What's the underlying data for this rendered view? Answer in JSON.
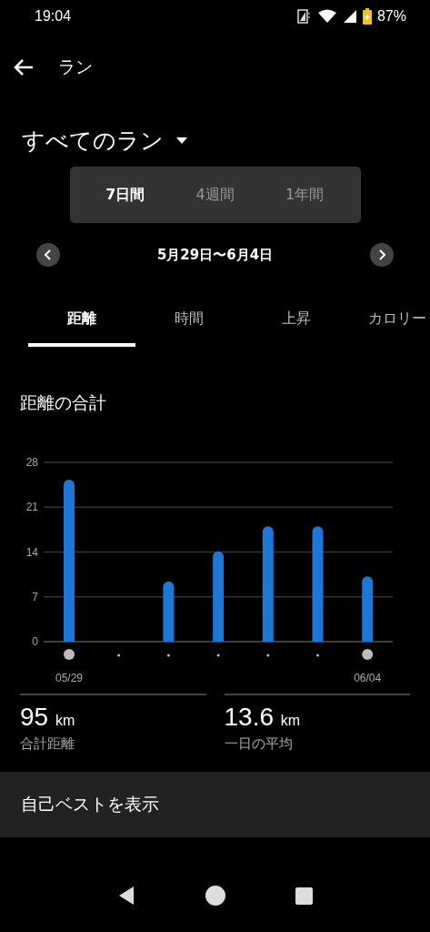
{
  "status_bar": {
    "time": "19:04",
    "battery": "87%"
  },
  "app_bar": {
    "title": "ラン"
  },
  "filter": {
    "label": "すべてのラン"
  },
  "periods": [
    {
      "label": "7日間",
      "selected": true
    },
    {
      "label": "4週間",
      "selected": false
    },
    {
      "label": "1年間",
      "selected": false
    }
  ],
  "date_range": "5月29日〜6月4日",
  "metric_tabs": [
    {
      "label": "距離",
      "selected": true
    },
    {
      "label": "時間",
      "selected": false
    },
    {
      "label": "上昇",
      "selected": false
    },
    {
      "label": "カロリー",
      "selected": false
    }
  ],
  "chart": {
    "title": "距離の合計",
    "chart_data": {
      "type": "bar",
      "categories": [
        "05/29",
        null,
        null,
        null,
        null,
        null,
        "06/04"
      ],
      "values": [
        25.3,
        0,
        9.4,
        14.1,
        18,
        18,
        10.2
      ],
      "ylim": [
        0,
        28
      ],
      "yticks": [
        0,
        7,
        14,
        21,
        28
      ],
      "grid": true
    }
  },
  "stats": [
    {
      "value": "95",
      "unit": "km",
      "label": "合計距離"
    },
    {
      "value": "13.6",
      "unit": "km",
      "label": "一日の平均"
    }
  ],
  "personal_best": {
    "label": "自己ベストを表示"
  }
}
